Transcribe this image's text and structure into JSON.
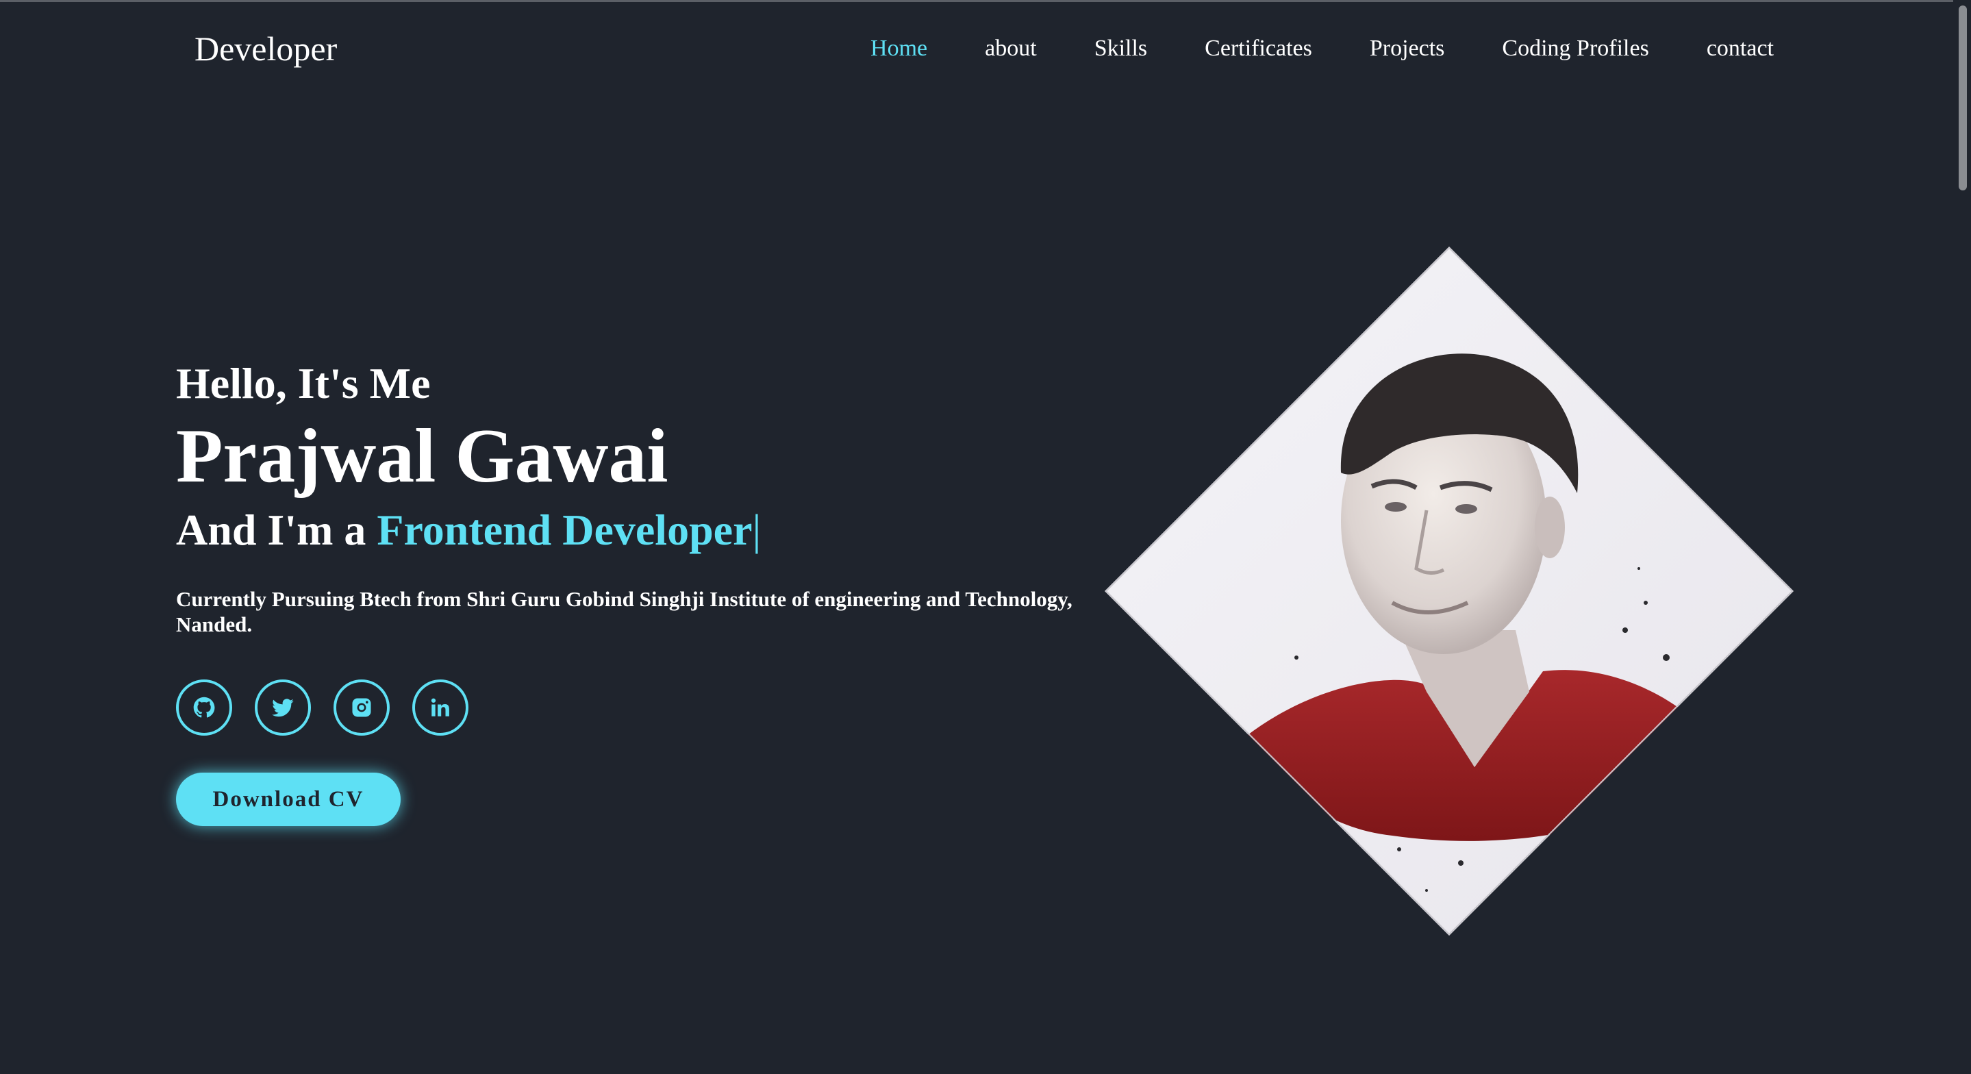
{
  "header": {
    "logo": "Developer",
    "nav": [
      {
        "label": "Home",
        "active": true
      },
      {
        "label": "about",
        "active": false
      },
      {
        "label": "Skills",
        "active": false
      },
      {
        "label": "Certificates",
        "active": false
      },
      {
        "label": "Projects",
        "active": false
      },
      {
        "label": "Coding Profiles",
        "active": false
      },
      {
        "label": "contact",
        "active": false
      }
    ]
  },
  "hero": {
    "greeting": "Hello, It's Me",
    "name": "Prajwal Gawai",
    "role_prefix": "And I'm a ",
    "role_highlight": "Frontend Developer",
    "cursor": "|",
    "description": "Currently Pursuing Btech from Shri Guru Gobind Singhji Institute of engineering and Technology, Nanded.",
    "socials": [
      {
        "name": "github",
        "icon": "github-icon"
      },
      {
        "name": "twitter",
        "icon": "twitter-icon"
      },
      {
        "name": "instagram",
        "icon": "instagram-icon"
      },
      {
        "name": "linkedin",
        "icon": "linkedin-icon"
      }
    ],
    "cta_label": "Download CV"
  },
  "colors": {
    "background": "#1f242d",
    "accent": "#5ee0f4",
    "text": "#ffffff"
  }
}
